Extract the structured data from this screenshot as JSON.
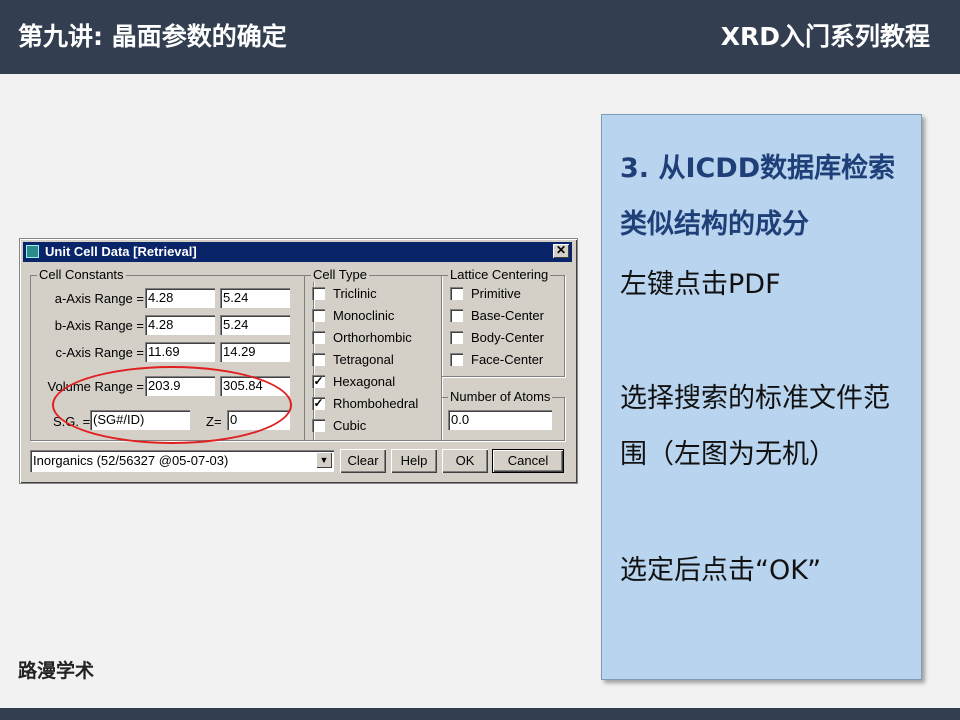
{
  "header": {
    "left_title": "第九讲: 晶面参数的确定",
    "right_title": "XRD入门系列教程"
  },
  "footer": {
    "org": "路漫学术"
  },
  "panel": {
    "heading": "3. 从ICDD数据库检索类似结构的成分",
    "step1": "左键点击PDF",
    "step2": "选择搜索的标准文件范围（左图为无机）",
    "step3": "选定后点击“OK”"
  },
  "dialog": {
    "title": "Unit Cell Data [Retrieval]",
    "close_glyph": "✕",
    "cell_constants": {
      "label": "Cell Constants",
      "a_label": "a-Axis Range =",
      "a_min": "4.28",
      "a_max": "5.24",
      "b_label": "b-Axis Range =",
      "b_min": "4.28",
      "b_max": "5.24",
      "c_label": "c-Axis Range =",
      "c_min": "11.69",
      "c_max": "14.29",
      "vol_label": "Volume Range =",
      "vol_min": "203.9",
      "vol_max": "305.84",
      "sg_label": "S.G. =",
      "sg_value": "(SG#/ID)",
      "z_label": "Z=",
      "z_value": "0"
    },
    "cell_type": {
      "label": "Cell Type",
      "options": [
        {
          "label": "Triclinic",
          "checked": false
        },
        {
          "label": "Monoclinic",
          "checked": false
        },
        {
          "label": "Orthorhombic",
          "checked": false
        },
        {
          "label": "Tetragonal",
          "checked": false
        },
        {
          "label": "Hexagonal",
          "checked": true
        },
        {
          "label": "Rhombohedral",
          "checked": true
        },
        {
          "label": "Cubic",
          "checked": false
        }
      ]
    },
    "lattice_centering": {
      "label": "Lattice Centering",
      "options": [
        {
          "label": "Primitive",
          "checked": false
        },
        {
          "label": "Base-Center",
          "checked": false
        },
        {
          "label": "Body-Center",
          "checked": false
        },
        {
          "label": "Face-Center",
          "checked": false
        }
      ]
    },
    "atoms": {
      "label": "Number of Atoms",
      "value": "0.0"
    },
    "database": {
      "selected": "Inorganics (52/56327 @05-07-03)",
      "arrow_glyph": "▼"
    },
    "buttons": {
      "clear": "Clear",
      "help": "Help",
      "ok": "OK",
      "cancel": "Cancel"
    },
    "check_glyph": "✓"
  }
}
